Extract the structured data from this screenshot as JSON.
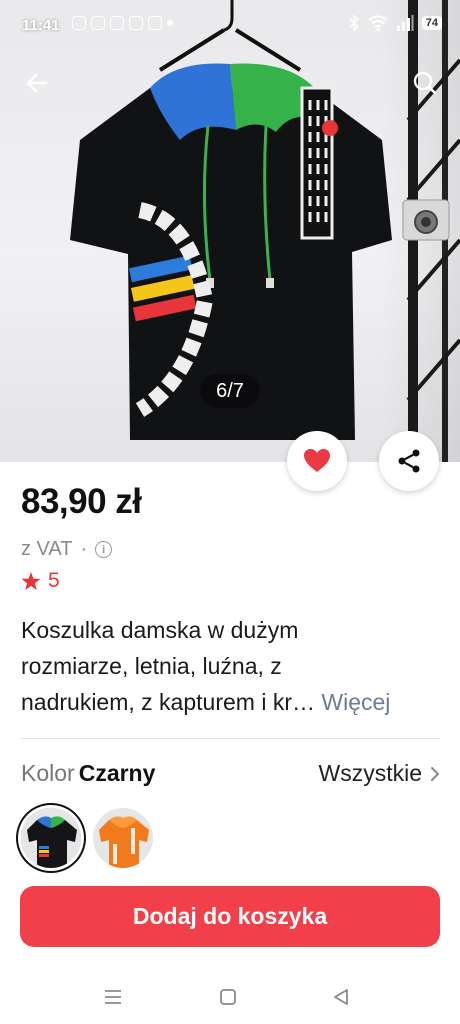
{
  "status_bar": {
    "time": "11:41",
    "battery": "74",
    "icons_left": [
      "notification-icon",
      "instagram-icon",
      "youtube-icon",
      "threads-icon",
      "instagram-icon",
      "dot-icon"
    ],
    "icons_right": [
      "bluetooth-icon",
      "wifi-icon",
      "signal-icon",
      "battery-icon"
    ]
  },
  "header": {
    "back_icon": "arrow-left-icon",
    "search_icon": "search-icon"
  },
  "gallery": {
    "counter": "6/7"
  },
  "actions": {
    "favorite_icon": "heart-icon",
    "share_icon": "share-icon"
  },
  "product": {
    "price": "83,90 zł",
    "vat": "z VAT",
    "vat_separator": "·",
    "rating": "5",
    "title_lines": [
      "Koszulka damska w dużym",
      "rozmiarze, letnia, luźna, z",
      "nadrukiem, z kapturem i kr…"
    ],
    "more_link": "Więcej"
  },
  "variant": {
    "label": "Kolor",
    "value": "Czarny",
    "all_link": "Wszystkie",
    "swatches": [
      {
        "name": "Czarny",
        "color": "#1b1b1d",
        "selected": true
      },
      {
        "name": "Pomarańczowy",
        "color": "#f07a1c",
        "selected": false
      }
    ]
  },
  "cart": {
    "button_label": "Dodaj do koszyka"
  },
  "colors": {
    "accent": "#f2404a",
    "rating": "#e8353a",
    "link": "#6c7b96"
  }
}
